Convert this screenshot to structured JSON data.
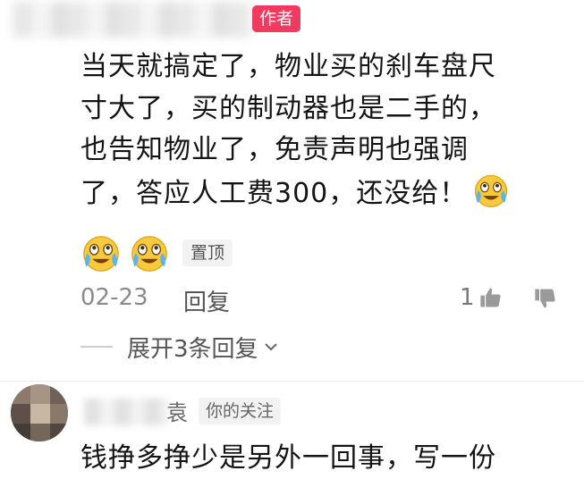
{
  "comment": {
    "author_badge": "作者",
    "lines": [
      "当天就搞定了，物业买的刹车盘尺",
      "寸大了，买的制动器也是二手的，",
      "也告知物业了，免责声明也强调",
      "了，答应人工费300，还没给！"
    ],
    "inline_emoji_icon": "crying-laughing-emoji",
    "emoji_row_icons": [
      "crying-laughing-emoji",
      "crying-laughing-emoji"
    ],
    "pin_label": "置顶",
    "date": "02-23",
    "reply_label": "回复",
    "like_count": "1",
    "like_icon": "thumbs-up-icon",
    "dislike_icon": "thumbs-down-icon",
    "expand_label": "展开3条回复",
    "expand_icon": "chevron-down-icon",
    "author_badge_color": "#f03a5f"
  },
  "next_comment": {
    "name_suffix": "袁",
    "follow_label": "你的关注",
    "text": "钱挣多挣少是另外一回事，写一份"
  }
}
